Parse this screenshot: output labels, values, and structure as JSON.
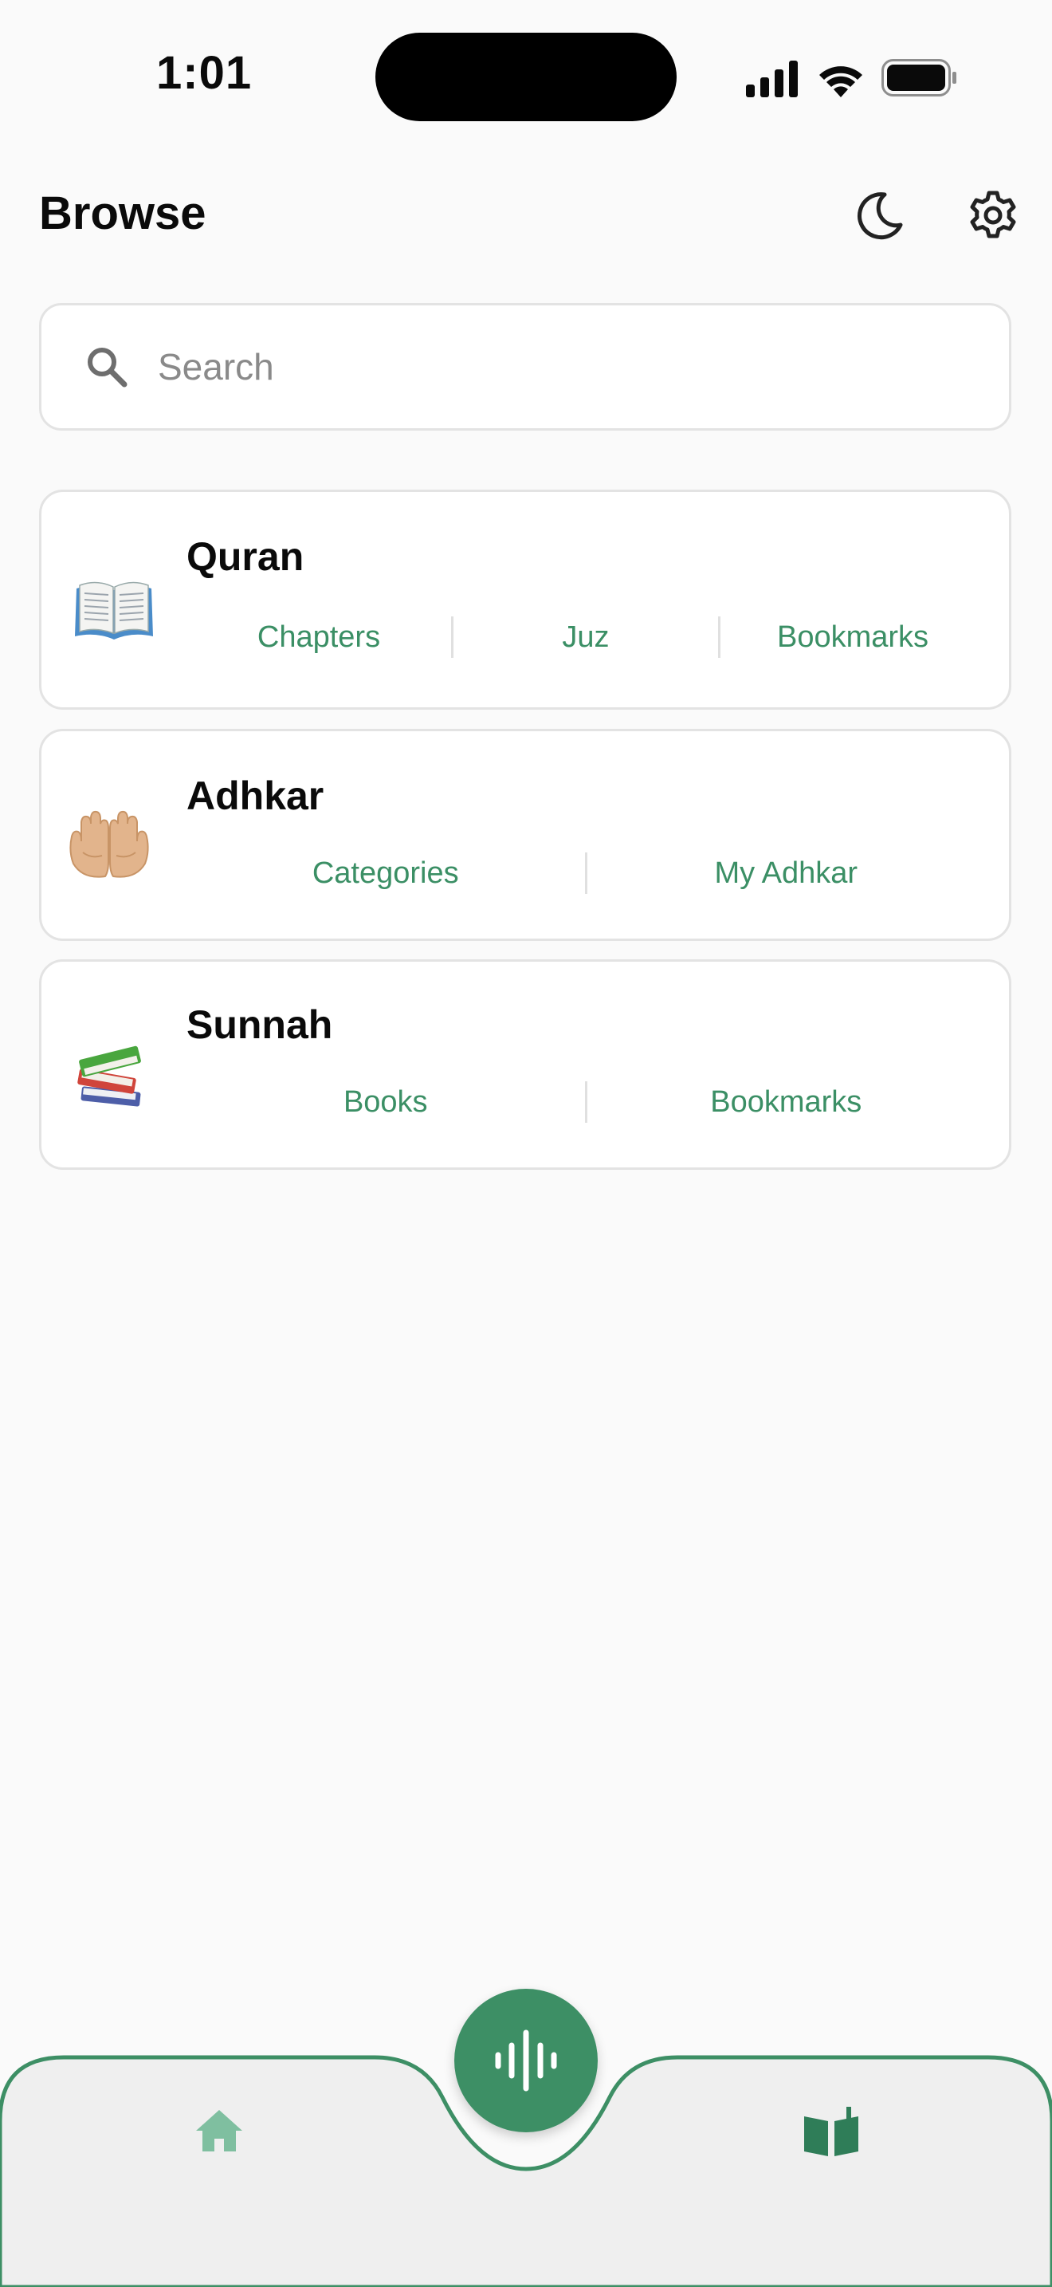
{
  "status_bar": {
    "time": "1:01"
  },
  "header": {
    "title": "Browse",
    "moon_icon": "moon-icon",
    "settings_icon": "gear-icon"
  },
  "search": {
    "placeholder": "Search",
    "icon": "search-icon"
  },
  "cards": [
    {
      "title": "Quran",
      "icon": "open-book-emoji",
      "links": [
        "Chapters",
        "Juz",
        "Bookmarks"
      ]
    },
    {
      "title": "Adhkar",
      "icon": "palms-up-emoji",
      "links": [
        "Categories",
        "My Adhkar"
      ]
    },
    {
      "title": "Sunnah",
      "icon": "books-emoji",
      "links": [
        "Books",
        "Bookmarks"
      ]
    }
  ],
  "tab_bar": {
    "home_icon": "home-icon",
    "center_icon": "audio-waveform-icon",
    "browse_icon": "open-book-icon"
  },
  "colors": {
    "accent": "#3d8f65",
    "link": "#3b8f65",
    "background": "#fafafa",
    "tab_background": "#efefef"
  }
}
